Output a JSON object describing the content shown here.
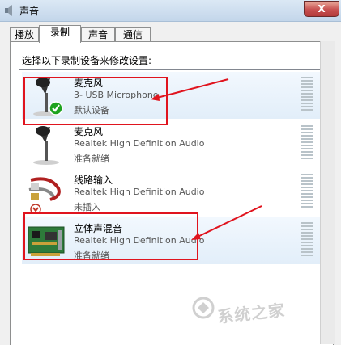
{
  "window": {
    "title": "声音",
    "close_label": "X"
  },
  "tabs": [
    {
      "label": "播放",
      "active": false
    },
    {
      "label": "录制",
      "active": true
    },
    {
      "label": "声音",
      "active": false
    },
    {
      "label": "通信",
      "active": false
    }
  ],
  "instruction": "选择以下录制设备来修改设置:",
  "devices": [
    {
      "name": "麦克风",
      "detail": "3- USB Microphone",
      "status": "默认设备",
      "icon": "microphone-icon",
      "badge": "green-check",
      "highlighted": true
    },
    {
      "name": "麦克风",
      "detail": "Realtek High Definition Audio",
      "status": "准备就绪",
      "icon": "microphone-icon",
      "badge": "",
      "highlighted": false
    },
    {
      "name": "线路输入",
      "detail": "Realtek High Definition Audio",
      "status": "未插入",
      "icon": "line-in-cable-icon",
      "badge": "red-down-arrow",
      "highlighted": false
    },
    {
      "name": "立体声混音",
      "detail": "Realtek High Definition Audio",
      "status": "准备就绪",
      "icon": "sound-card-icon",
      "badge": "",
      "highlighted": true
    }
  ],
  "watermark": "系统之家",
  "colors": {
    "highlight_box": "#e0141e",
    "selected_row": "#e8f1fb"
  }
}
